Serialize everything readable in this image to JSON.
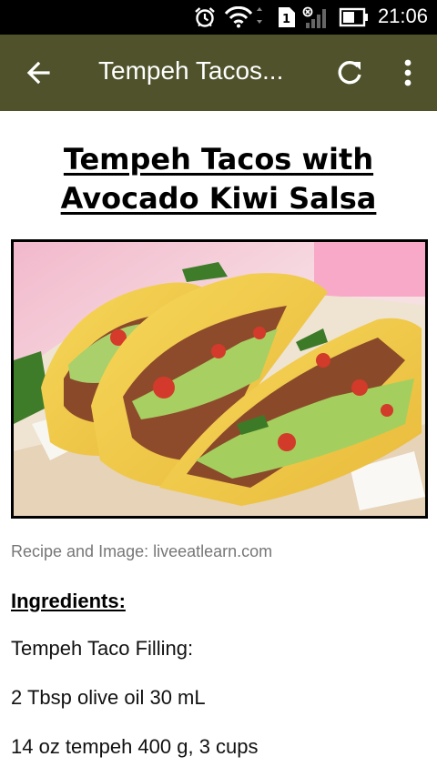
{
  "status_bar": {
    "time": "21:06",
    "sim_number": "1",
    "icons": [
      "alarm-icon",
      "wifi-icon",
      "sim-icon",
      "signal-icon",
      "battery-icon"
    ]
  },
  "app_bar": {
    "title": "Tempeh Tacos...",
    "background": "#4f522a",
    "icons": [
      "back-arrow-icon",
      "refresh-icon",
      "more-vert-icon"
    ]
  },
  "recipe": {
    "title_line1": "Tempeh Tacos with",
    "title_line2": "Avocado Kiwi Salsa",
    "credit": "Recipe and Image: liveeatlearn.com",
    "ingredients_heading": "Ingredients:",
    "ingredient_lines": [
      "Tempeh Taco Filling:",
      "2 Tbsp olive oil 30 mL",
      "14 oz tempeh 400 g, 3 cups"
    ]
  }
}
